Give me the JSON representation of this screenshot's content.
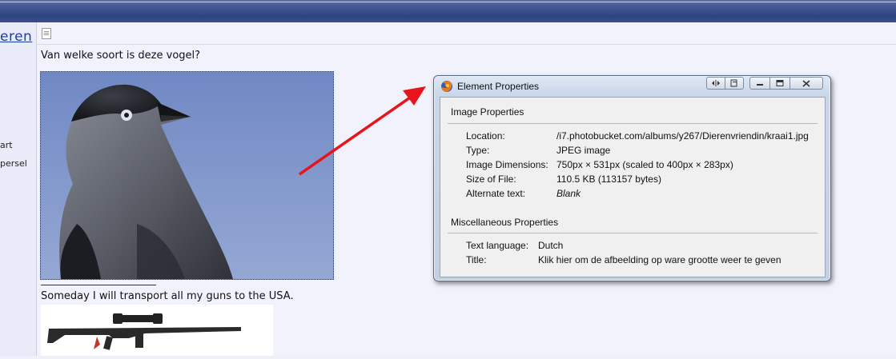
{
  "left_panel": {
    "link": "eren",
    "items": [
      "art",
      "persel"
    ]
  },
  "post": {
    "question": "Van welke soort is deze vogel?",
    "signature": "Someday I will transport all my guns to the USA."
  },
  "dialog": {
    "title": "Element Properties",
    "section1": {
      "title": "Image Properties",
      "rows": [
        {
          "label": "Location:",
          "value": "/i7.photobucket.com/albums/y267/Dierenvriendin/kraai1.jpg"
        },
        {
          "label": "Type:",
          "value": "JPEG image"
        },
        {
          "label": "Image Dimensions:",
          "value": "750px × 531px (scaled to 400px × 283px)"
        },
        {
          "label": "Size of File:",
          "value": "110.5 KB (113157 bytes)"
        },
        {
          "label": "Alternate text:",
          "value": "Blank"
        }
      ]
    },
    "section2": {
      "title": "Miscellaneous Properties",
      "rows": [
        {
          "label": "Text language:",
          "value": "Dutch"
        },
        {
          "label": "Title:",
          "value": "Klik hier om de afbeelding op ware grootte weer te geven"
        }
      ]
    }
  },
  "colors": {
    "arrow": "#e8141c",
    "link": "#1a3ea8",
    "header": "#2e4380"
  }
}
